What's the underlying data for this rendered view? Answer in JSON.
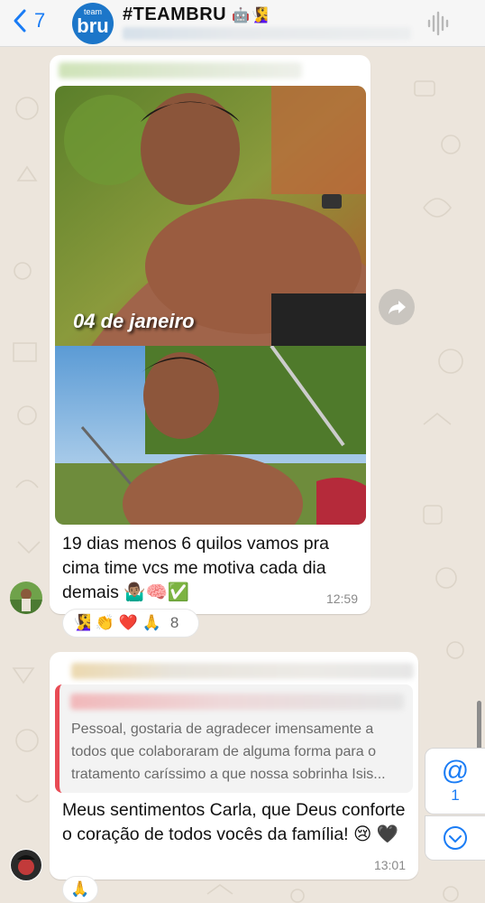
{
  "header": {
    "back_count": "7",
    "avatar_small": "team",
    "avatar_big": "bru",
    "title": "#TEAMBRU",
    "title_emojis": "🤖🧏‍♀️"
  },
  "messages": [
    {
      "photo_caption": "04 de janeiro",
      "text": "19 dias  menos  6 quilos vamos pra cima time vcs me motiva cada dia demais  🤷🏽‍♂️🧠✅",
      "time": "12:59",
      "reactions": "🧏‍♀️ 👏 ❤️ 🙏",
      "reaction_count": "8"
    },
    {
      "quoted_text": "Pessoal, gostaria de agradecer imensamente a todos que colaboraram de alguma forma para o tratamento caríssimo a que nossa sobrinha Isis...",
      "text": "Meus sentimentos Carla, que Deus conforte o coração de todos vocês da família! 😢 🖤",
      "time": "13:01",
      "reactions": "🙏"
    }
  ],
  "mention": {
    "symbol": "@",
    "count": "1"
  },
  "colors": {
    "accent": "#1a7cf5",
    "quote_bar": "#e84b55",
    "background": "#ece5dc"
  }
}
